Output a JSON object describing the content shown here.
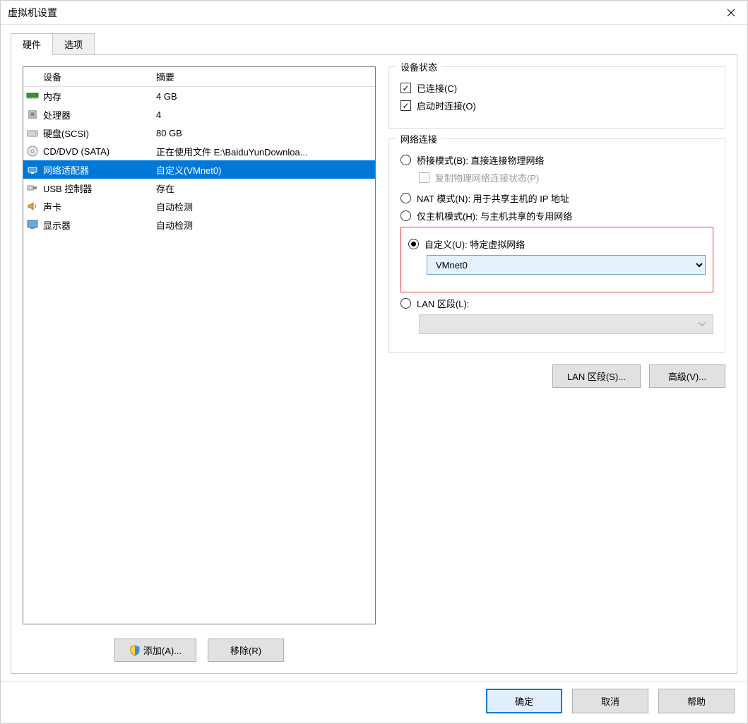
{
  "window": {
    "title": "虚拟机设置"
  },
  "tabs": {
    "hardware": "硬件",
    "options": "选项"
  },
  "list": {
    "header_device": "设备",
    "header_summary": "摘要",
    "rows": [
      {
        "name": "内存",
        "summary": "4 GB"
      },
      {
        "name": "处理器",
        "summary": "4"
      },
      {
        "name": "硬盘(SCSI)",
        "summary": "80 GB"
      },
      {
        "name": "CD/DVD (SATA)",
        "summary": "正在使用文件 E:\\BaiduYunDownloa..."
      },
      {
        "name": "网络适配器",
        "summary": "自定义(VMnet0)"
      },
      {
        "name": "USB 控制器",
        "summary": "存在"
      },
      {
        "name": "声卡",
        "summary": "自动检测"
      },
      {
        "name": "显示器",
        "summary": "自动检测"
      }
    ]
  },
  "left_buttons": {
    "add": "添加(A)...",
    "remove": "移除(R)"
  },
  "device_status": {
    "title": "设备状态",
    "connected": "已连接(C)",
    "connect_power": "启动时连接(O)"
  },
  "network": {
    "title": "网络连接",
    "bridge": "桥接模式(B): 直接连接物理网络",
    "copy_state": "复制物理网络连接状态(P)",
    "nat": "NAT 模式(N): 用于共享主机的 IP 地址",
    "hostonly": "仅主机模式(H): 与主机共享的专用网络",
    "custom": "自定义(U): 特定虚拟网络",
    "custom_value": "VMnet0",
    "lan": "LAN 区段(L):",
    "lan_btn": "LAN 区段(S)...",
    "adv_btn": "高级(V)..."
  },
  "bottom": {
    "ok": "确定",
    "cancel": "取消",
    "help": "帮助"
  }
}
